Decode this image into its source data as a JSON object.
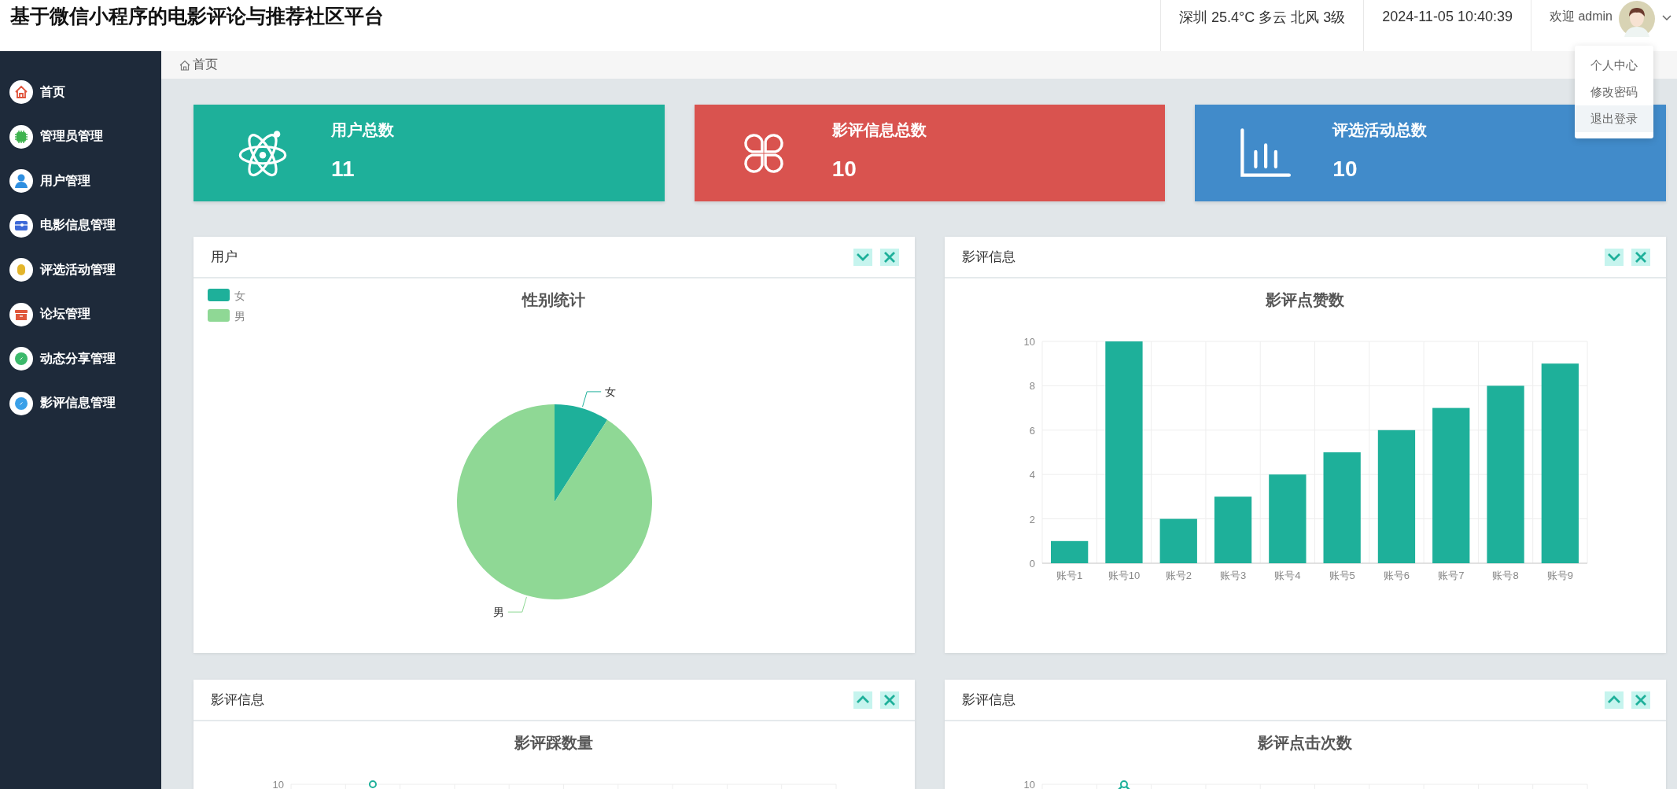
{
  "header": {
    "title": "基于微信小程序的电影评论与推荐社区平台",
    "weather": "深圳 25.4°C 多云 北风 3级",
    "datetime": "2024-11-05 10:40:39",
    "welcome": "欢迎 admin",
    "user_menu": [
      {
        "label": "个人中心",
        "selected": false
      },
      {
        "label": "修改密码",
        "selected": false
      },
      {
        "label": "退出登录",
        "selected": true
      }
    ]
  },
  "sidebar": {
    "items": [
      {
        "label": "首页",
        "kind": "home",
        "color": "#e0533a"
      },
      {
        "label": "管理员管理",
        "kind": "chip",
        "color": "#3fb34f"
      },
      {
        "label": "用户管理",
        "kind": "user",
        "color": "#2f8fe0"
      },
      {
        "label": "电影信息管理",
        "kind": "card",
        "color": "#3e6ad8"
      },
      {
        "label": "评选活动管理",
        "kind": "capsule",
        "color": "#e3b52b"
      },
      {
        "label": "论坛管理",
        "kind": "box",
        "color": "#e0583c"
      },
      {
        "label": "动态分享管理",
        "kind": "disc",
        "color": "#3cb96b"
      },
      {
        "label": "影评信息管理",
        "kind": "disc",
        "color": "#3aa0e8"
      }
    ]
  },
  "breadcrumb": "首页",
  "stats": [
    {
      "label": "用户总数",
      "value": "11",
      "kind": "atom",
      "color": "#1eb09a"
    },
    {
      "label": "影评信息总数",
      "value": "10",
      "kind": "clover",
      "color": "#d9534f"
    },
    {
      "label": "评选活动总数",
      "value": "10",
      "kind": "bars",
      "color": "#418bca"
    }
  ],
  "panels": [
    {
      "title": "用户",
      "toggle_up": false,
      "chart_data": {
        "type": "pie",
        "title": "性别统计",
        "categories": [
          "女",
          "男"
        ],
        "values": [
          9.1,
          90.9
        ],
        "legend": true
      }
    },
    {
      "title": "影评信息",
      "toggle_up": false,
      "chart_data": {
        "type": "bar",
        "title": "影评点赞数",
        "categories": [
          "账号1",
          "账号10",
          "账号2",
          "账号3",
          "账号4",
          "账号5",
          "账号6",
          "账号7",
          "账号8",
          "账号9"
        ],
        "values": [
          1,
          10,
          2,
          3,
          4,
          5,
          6,
          7,
          8,
          9
        ],
        "ylim": [
          0,
          10
        ],
        "yticks": [
          0,
          2,
          4,
          6,
          8,
          10
        ],
        "grid": true
      }
    },
    {
      "title": "影评信息",
      "toggle_up": true,
      "chart_title": "影评踩数量",
      "top_tick": "10",
      "kind": "line_dot"
    },
    {
      "title": "影评信息",
      "toggle_up": true,
      "chart_title": "影评点击次数",
      "top_tick": "10",
      "kind": "line_peak"
    }
  ]
}
